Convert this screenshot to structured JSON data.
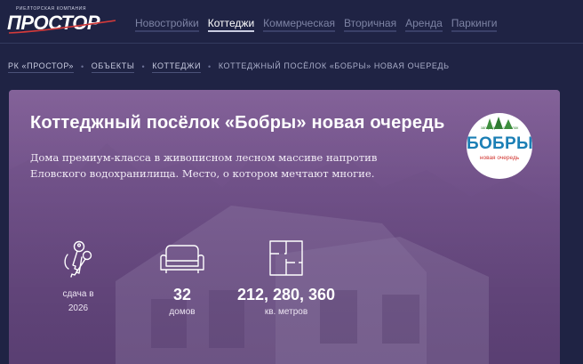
{
  "brand": {
    "tagline": "РИЕЛТОРСКАЯ КОМПАНИЯ",
    "name": "ПРОСТОР"
  },
  "nav": {
    "items": [
      {
        "label": "Новостройки",
        "active": false
      },
      {
        "label": "Коттеджи",
        "active": true
      },
      {
        "label": "Коммерческая",
        "active": false
      },
      {
        "label": "Вторичная",
        "active": false
      },
      {
        "label": "Аренда",
        "active": false
      },
      {
        "label": "Паркинги",
        "active": false
      }
    ]
  },
  "breadcrumb": {
    "items": [
      "РК «ПРОСТОР»",
      "ОБЪЕКТЫ",
      "КОТТЕДЖИ"
    ],
    "current": "КОТТЕДЖНЫЙ ПОСЁЛОК «БОБРЫ» НОВАЯ ОЧЕРЕДЬ",
    "separator": "•"
  },
  "hero": {
    "title": "Коттеджный посёлок «Бобры» новая очередь",
    "description": "Дома премиум-класса в живописном лесном массиве напротив Еловского водохранилища. Место, о котором мечтают многие.",
    "badge": {
      "top": "загородный посёлок",
      "name": "БОБРЫ",
      "sub": "новая очередь"
    }
  },
  "stats": {
    "delivery": {
      "icon": "keys-icon",
      "line1": "сдача в",
      "line2": "2026"
    },
    "houses": {
      "icon": "sofa-icon",
      "value": "32",
      "caption": "домов"
    },
    "area": {
      "icon": "floorplan-icon",
      "value": "212, 280, 360",
      "caption": "кв. метров"
    }
  },
  "colors": {
    "page_bg": "#1f2344",
    "hero_bg": "#6d4c86",
    "nav_inactive": "#7d83a4",
    "badge_blue": "#1b7fb5",
    "badge_red": "#d0332e"
  }
}
